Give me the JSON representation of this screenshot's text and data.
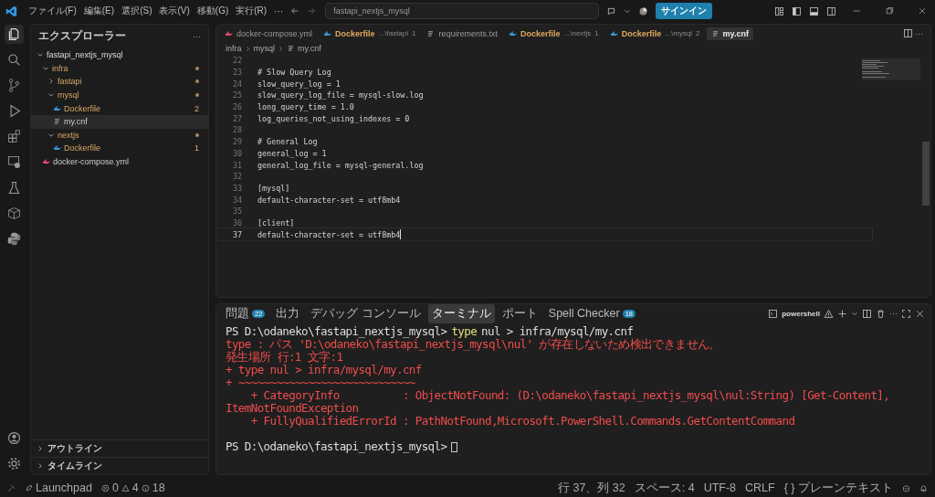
{
  "menu": [
    "ファイル(F)",
    "編集(E)",
    "選択(S)",
    "表示(V)",
    "移動(G)",
    "実行(R)",
    "···"
  ],
  "search": {
    "value": "fastapi_nextjs_mysql"
  },
  "sign_in": "サインイン",
  "explorer": {
    "title": "エクスプローラー",
    "more": "···",
    "tree": [
      {
        "label": "fastapi_nextjs_mysql",
        "kind": "root",
        "expanded": true,
        "children": [
          {
            "label": "infra",
            "kind": "folder",
            "expanded": true,
            "modified": true,
            "children": [
              {
                "label": "fastapi",
                "kind": "folder",
                "expanded": false,
                "modified": true
              },
              {
                "label": "mysql",
                "kind": "folder",
                "expanded": true,
                "modified": true,
                "children": [
                  {
                    "label": "Dockerfile",
                    "kind": "docker",
                    "badge": "2",
                    "selected": false
                  },
                  {
                    "label": "my.cnf",
                    "kind": "file",
                    "selected": true
                  }
                ]
              },
              {
                "label": "nextjs",
                "kind": "folder",
                "expanded": true,
                "modified": true,
                "children": [
                  {
                    "label": "Dockerfile",
                    "kind": "docker",
                    "badge": "1",
                    "selected": false
                  }
                ]
              }
            ]
          },
          {
            "label": "docker-compose.yml",
            "kind": "compose",
            "selected": false
          }
        ]
      }
    ],
    "sections": [
      {
        "label": "アウトライン",
        "expanded": false
      },
      {
        "label": "タイムライン",
        "expanded": false
      }
    ]
  },
  "tabs": [
    {
      "label": "docker-compose.yml",
      "kind": "compose",
      "selected": false
    },
    {
      "label": "Dockerfile",
      "description": "...\\fastapi",
      "count": "1",
      "kind": "docker",
      "selected": false
    },
    {
      "label": "requirements.txt",
      "kind": "file",
      "selected": false
    },
    {
      "label": "Dockerfile",
      "description": "...\\nextjs",
      "count": "1",
      "kind": "docker",
      "selected": false
    },
    {
      "label": "Dockerfile",
      "description": "...\\mysql",
      "count": "2",
      "kind": "docker",
      "selected": false
    },
    {
      "label": "my.cnf",
      "kind": "file",
      "selected": true
    }
  ],
  "breadcrumb": [
    "infra",
    "mysql",
    "my.cnf"
  ],
  "code": [
    {
      "n": "22",
      "current": false
    },
    {
      "n": "23",
      "text": "# Slow Query Log",
      "current": false
    },
    {
      "n": "24",
      "text": "slow_query_log = 1",
      "current": false
    },
    {
      "n": "25",
      "text": "slow_query_log_file = mysql-slow.log",
      "current": false
    },
    {
      "n": "26",
      "text": "long_query_time = 1.0",
      "current": false
    },
    {
      "n": "27",
      "text": "log_queries_not_using_indexes = 0",
      "current": false
    },
    {
      "n": "28",
      "current": false
    },
    {
      "n": "29",
      "text": "# General Log",
      "current": false
    },
    {
      "n": "30",
      "text": "general_log = 1",
      "current": false
    },
    {
      "n": "31",
      "text": "general_log_file = mysql-general.log",
      "current": false
    },
    {
      "n": "32",
      "current": false
    },
    {
      "n": "33",
      "text": "[mysql]",
      "current": false
    },
    {
      "n": "34",
      "text": "default-character-set = utf8mb4",
      "current": false
    },
    {
      "n": "35",
      "current": false
    },
    {
      "n": "36",
      "text": "[client]",
      "current": false
    },
    {
      "n": "37",
      "text": "default-character-set = utf8mb4",
      "current": true
    }
  ],
  "panel_tabs": [
    {
      "label": "問題",
      "badge": "22",
      "selected": false
    },
    {
      "label": "出力",
      "selected": false
    },
    {
      "label": "デバッグ コンソール",
      "selected": false
    },
    {
      "label": "ターミナル",
      "selected": true
    },
    {
      "label": "ポート",
      "selected": false
    },
    {
      "label": "Spell Checker",
      "badge": "18",
      "selected": false
    }
  ],
  "terminal_name": "powershell",
  "terminal": [
    {
      "kind": "prompt",
      "prompt": "PS D:\\odaneko\\fastapi_nextjs_mysql>",
      "command": "type",
      "args": "nul > infra/mysql/my.cnf"
    },
    {
      "kind": "error",
      "text": "type : パス 'D:\\odaneko\\fastapi_nextjs_mysql\\nul' が存在しないため検出できません。"
    },
    {
      "kind": "error",
      "text": "発生場所 行:1 文字:1"
    },
    {
      "kind": "error",
      "text": "+ type nul > infra/mysql/my.cnf"
    },
    {
      "kind": "error",
      "text": "+ ~~~~~~~~~~~~~~~~~~~~~~~~~~~~"
    },
    {
      "kind": "error",
      "text": "    + CategoryInfo          : ObjectNotFound: (D:\\odaneko\\fastapi_nextjs_mysql\\nul:String) [Get-Content], ItemNotFoundException"
    },
    {
      "kind": "error",
      "text": "    + FullyQualifiedErrorId : PathNotFound,Microsoft.PowerShell.Commands.GetContentCommand"
    },
    {
      "kind": "blank"
    },
    {
      "kind": "prompt",
      "prompt": "PS D:\\odaneko\\fastapi_nextjs_mysql>",
      "cursor": true
    }
  ],
  "status": {
    "launchpad": "Launchpad",
    "errors": "0",
    "warnings": "4",
    "infos": "18",
    "right": [
      "行 37、列 32",
      "スペース: 4",
      "UTF-8",
      "CRLF"
    ],
    "language_icon": "{ }",
    "language": "プレーンテキスト"
  }
}
